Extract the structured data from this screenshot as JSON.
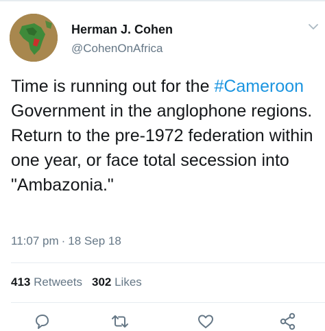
{
  "author": {
    "name": "Herman J. Cohen",
    "handle": "@CohenOnAfrica"
  },
  "tweet": {
    "text_before": "Time is running out for the ",
    "hashtag": "#Cameroon",
    "text_after": " Government in the anglophone regions. Return to the pre-1972 federation within one year, or face total secession into \"Ambazonia.\""
  },
  "meta": {
    "time": "11:07 pm",
    "separator": "·",
    "date": "18 Sep 18"
  },
  "stats": {
    "retweets_count": "413",
    "retweets_label": "Retweets",
    "likes_count": "302",
    "likes_label": "Likes"
  },
  "icons": {
    "more": "chevron-down-icon",
    "reply": "reply-icon",
    "retweet": "retweet-icon",
    "like": "heart-icon",
    "share": "share-icon"
  },
  "colors": {
    "hashtag": "#1b95e0",
    "secondary_text": "#657786",
    "divider": "#e6ecf0"
  }
}
